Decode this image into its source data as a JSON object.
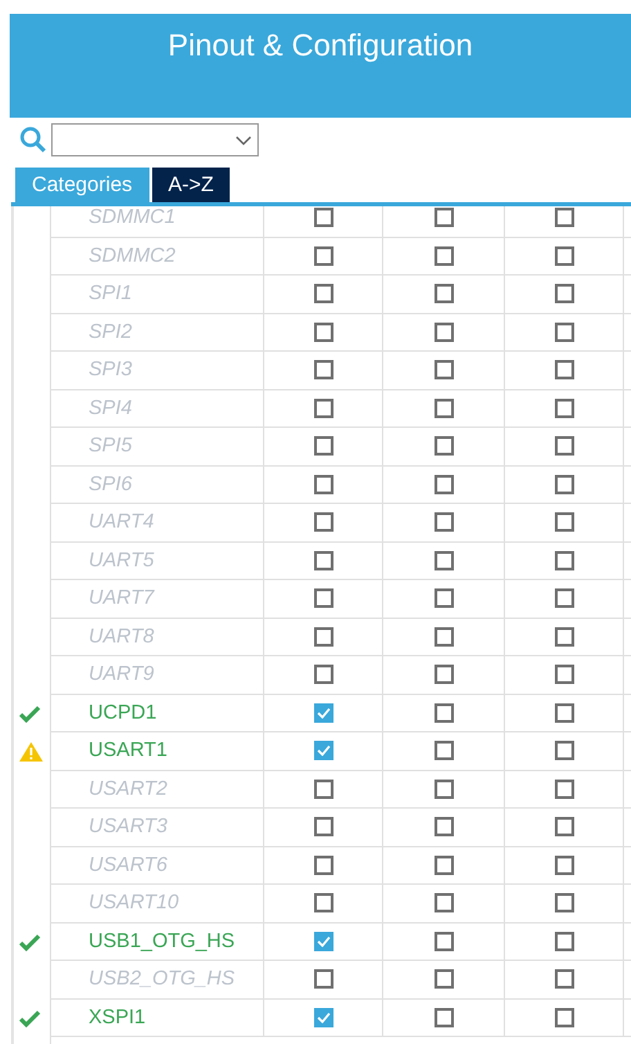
{
  "header": {
    "title": "Pinout & Configuration"
  },
  "tabs": [
    {
      "label": "Categories",
      "selected": true
    },
    {
      "label": "A->Z",
      "selected": false
    }
  ],
  "rows": [
    {
      "kind": "plain",
      "name": "SDMMC1",
      "disabled": true,
      "checks": [
        false,
        false,
        false
      ]
    },
    {
      "kind": "plain",
      "name": "SDMMC2",
      "disabled": true,
      "checks": [
        false,
        false,
        false
      ]
    },
    {
      "kind": "plain",
      "name": "SPI1",
      "disabled": true,
      "checks": [
        false,
        false,
        false
      ]
    },
    {
      "kind": "plain",
      "name": "SPI2",
      "disabled": true,
      "checks": [
        false,
        false,
        false
      ]
    },
    {
      "kind": "plain",
      "name": "SPI3",
      "disabled": true,
      "checks": [
        false,
        false,
        false
      ]
    },
    {
      "kind": "plain",
      "name": "SPI4",
      "disabled": true,
      "checks": [
        false,
        false,
        false
      ]
    },
    {
      "kind": "plain",
      "name": "SPI5",
      "disabled": true,
      "checks": [
        false,
        false,
        false
      ]
    },
    {
      "kind": "plain",
      "name": "SPI6",
      "disabled": true,
      "checks": [
        false,
        false,
        false
      ]
    },
    {
      "kind": "plain",
      "name": "UART4",
      "disabled": true,
      "checks": [
        false,
        false,
        false
      ]
    },
    {
      "kind": "plain",
      "name": "UART5",
      "disabled": true,
      "checks": [
        false,
        false,
        false
      ]
    },
    {
      "kind": "plain",
      "name": "UART7",
      "disabled": true,
      "checks": [
        false,
        false,
        false
      ]
    },
    {
      "kind": "plain",
      "name": "UART8",
      "disabled": true,
      "checks": [
        false,
        false,
        false
      ]
    },
    {
      "kind": "plain",
      "name": "UART9",
      "disabled": true,
      "checks": [
        false,
        false,
        false
      ]
    },
    {
      "kind": "configured",
      "name": "UCPD1",
      "disabled": false,
      "checks": [
        true,
        false,
        false
      ]
    },
    {
      "kind": "warning",
      "name": "USART1",
      "disabled": false,
      "checks": [
        true,
        false,
        false
      ]
    },
    {
      "kind": "plain",
      "name": "USART2",
      "disabled": true,
      "checks": [
        false,
        false,
        false
      ]
    },
    {
      "kind": "plain",
      "name": "USART3",
      "disabled": true,
      "checks": [
        false,
        false,
        false
      ]
    },
    {
      "kind": "plain",
      "name": "USART6",
      "disabled": true,
      "checks": [
        false,
        false,
        false
      ]
    },
    {
      "kind": "plain",
      "name": "USART10",
      "disabled": true,
      "checks": [
        false,
        false,
        false
      ]
    },
    {
      "kind": "configured",
      "name": "USB1_OTG_HS",
      "disabled": false,
      "checks": [
        true,
        false,
        false
      ]
    },
    {
      "kind": "plain",
      "name": "USB2_OTG_HS",
      "disabled": true,
      "checks": [
        false,
        false,
        false
      ]
    },
    {
      "kind": "configured",
      "name": "XSPI1",
      "disabled": false,
      "checks": [
        true,
        false,
        false
      ]
    }
  ]
}
